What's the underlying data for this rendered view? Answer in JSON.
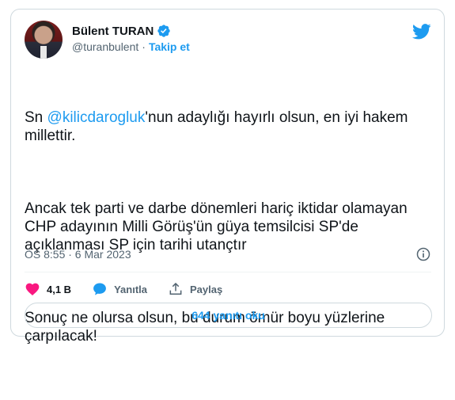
{
  "author": {
    "name": "Bülent TURAN",
    "handle": "@turanbulent",
    "separator": "·",
    "follow_label": "Takip et"
  },
  "tweet": {
    "p1_prefix": "Sn ",
    "p1_mention": "@kilicdarogluk",
    "p1_suffix": "'nun adaylığı hayırlı olsun, en iyi hakem millettir.",
    "p2": "Ancak tek parti ve darbe dönemleri hariç iktidar olamayan CHP adayının Milli Görüş'ün güya temsilcisi SP'de açıklanması SP için tarihi utançtır",
    "p3": "Sonuç ne olursa olsun, bu durum ömür boyu yüzlerine çarpılacak!"
  },
  "meta": {
    "timestamp": "ÖS 8:55 · 6 Mar 2023"
  },
  "actions": {
    "likes": "4,1 B",
    "reply_label": "Yanıtla",
    "share_label": "Paylaş"
  },
  "replies_button": "644 yanıtı oku",
  "icons": [
    "verified-icon",
    "twitter-bird-icon",
    "info-icon",
    "heart-icon",
    "reply-icon",
    "share-icon"
  ],
  "colors": {
    "accent": "#1d9bf0",
    "like": "#f91880",
    "secondary_text": "#536471",
    "border": "#cfd9de"
  }
}
